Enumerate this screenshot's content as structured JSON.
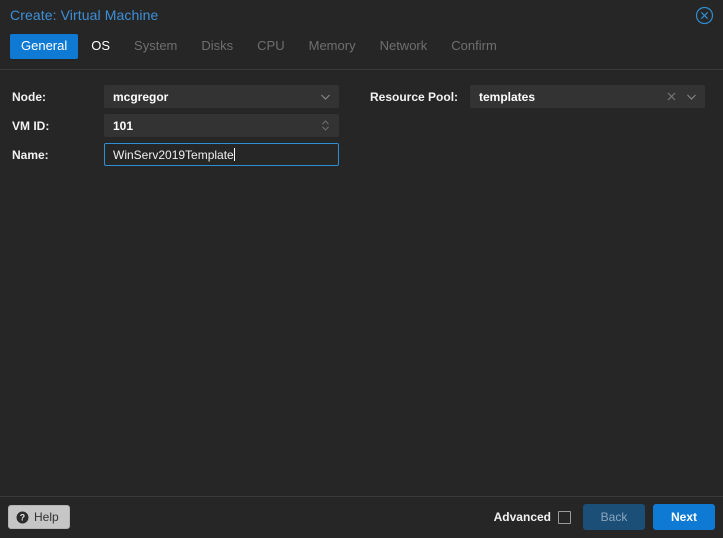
{
  "window": {
    "title": "Create: Virtual Machine",
    "close_icon": "close-circle-icon"
  },
  "tabs": [
    {
      "label": "General",
      "state": "active"
    },
    {
      "label": "OS",
      "state": "enabled"
    },
    {
      "label": "System",
      "state": "disabled"
    },
    {
      "label": "Disks",
      "state": "disabled"
    },
    {
      "label": "CPU",
      "state": "disabled"
    },
    {
      "label": "Memory",
      "state": "disabled"
    },
    {
      "label": "Network",
      "state": "disabled"
    },
    {
      "label": "Confirm",
      "state": "disabled"
    }
  ],
  "form": {
    "node": {
      "label": "Node:",
      "value": "mcgregor",
      "dropdown_icon": "chevron-down-icon"
    },
    "vmid": {
      "label": "VM ID:",
      "value": "101",
      "spinner_icon": "spinner-up-down-icon"
    },
    "name": {
      "label": "Name:",
      "value": "WinServ2019Template",
      "focused": true
    },
    "resource_pool": {
      "label": "Resource Pool:",
      "value": "templates",
      "clear_icon": "clear-x-icon",
      "dropdown_icon": "chevron-down-icon"
    }
  },
  "footer": {
    "help_label": "Help",
    "help_icon": "question-circle-icon",
    "advanced_label": "Advanced",
    "advanced_checked": false,
    "back_label": "Back",
    "back_disabled": true,
    "next_label": "Next"
  },
  "colors": {
    "background": "#262626",
    "accent": "#0e7ad4",
    "title": "#3d90d8",
    "field_bg": "#333333",
    "focus_border": "#2f8fd4",
    "disabled_text": "#6f6f6f",
    "back_button": "#1b4f78",
    "help_button": "#c6c6c6"
  }
}
